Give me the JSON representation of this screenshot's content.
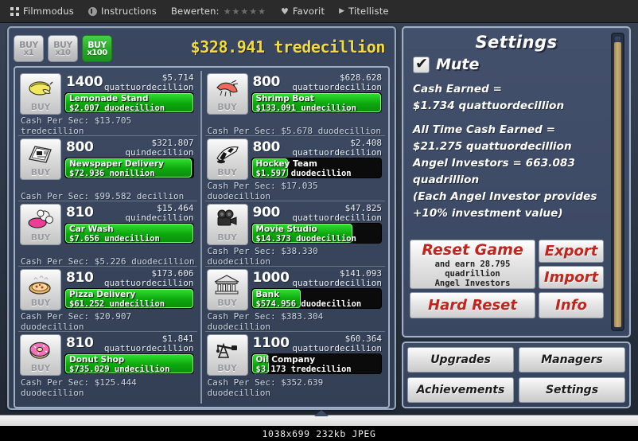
{
  "viewer": {
    "toolbar": [
      {
        "label": "Filmmodus",
        "icon": "grid-icon"
      },
      {
        "label": "Instructions",
        "icon": "info-circle-icon"
      },
      {
        "label": "Bewerten:",
        "icon": "none"
      },
      {
        "label": "Favorit",
        "icon": "heart-icon"
      },
      {
        "label": "Titelliste",
        "icon": "play-icon"
      }
    ],
    "stars": "★★★★★",
    "status": "1038x699  232kb  JPEG"
  },
  "game": {
    "buy_buttons": [
      {
        "line1": "BUY",
        "line2": "x1",
        "active": false
      },
      {
        "line1": "BUY",
        "line2": "x10",
        "active": false
      },
      {
        "line1": "BUY",
        "line2": "x100",
        "active": true
      }
    ],
    "cash": "$328.941 tredecillion",
    "buy_label": "BUY",
    "businesses_left": [
      {
        "name": "Lemonade Stand",
        "icon": "lemon-icon",
        "qty": "1400",
        "price_1": "$5.714",
        "price_2": "quattuordecillion",
        "revenue": "$2.007  duodecillion",
        "cps": "Cash Per Sec: $13.705 tredecillion",
        "progress": 100
      },
      {
        "name": "Newspaper Delivery",
        "icon": "newspaper-icon",
        "qty": "800",
        "price_1": "$321.807",
        "price_2": "quindecillion",
        "revenue": "$72.936  nonillion",
        "cps": "Cash Per Sec: $99.582 decillion",
        "progress": 99
      },
      {
        "name": "Car Wash",
        "icon": "car-wash-icon",
        "qty": "810",
        "price_1": "$15.464",
        "price_2": "quindecillion",
        "revenue": "$7.656  undecillion",
        "cps": "Cash Per Sec: $5.226 duodecillion",
        "progress": 100
      },
      {
        "name": "Pizza Delivery",
        "icon": "pizza-icon",
        "qty": "810",
        "price_1": "$173.606",
        "price_2": "quattuordecillion",
        "revenue": "$61.252  undecillion",
        "cps": "Cash Per Sec: $20.907 duodecillion",
        "progress": 100
      },
      {
        "name": "Donut Shop",
        "icon": "donut-icon",
        "qty": "810",
        "price_1": "$1.841",
        "price_2": "quattuordecillion",
        "revenue": "$735.029  undecillion",
        "cps": "Cash Per Sec: $125.444 duodecillion",
        "progress": 100
      }
    ],
    "businesses_right": [
      {
        "name": "Shrimp Boat",
        "icon": "shrimp-icon",
        "qty": "800",
        "price_1": "$628.628",
        "price_2": "quattuordecillion",
        "revenue": "$133.091 undecillion",
        "cps": "Cash Per Sec: $5.678 duodecillion",
        "progress": 100
      },
      {
        "name": "Hockey Team",
        "icon": "hockey-icon",
        "qty": "800",
        "price_1": "$2.408",
        "price_2": "quattuordecillion",
        "revenue": "$1.597  duodecillion",
        "cps": "Cash Per Sec: $17.035 duodecillion",
        "progress": 28
      },
      {
        "name": "Movie Studio",
        "icon": "movie-camera-icon",
        "qty": "900",
        "price_1": "$47.825",
        "price_2": "quattuordecillion",
        "revenue": "$14.373  duodecillion",
        "cps": "Cash Per Sec: $38.330 duodecillion",
        "progress": 78
      },
      {
        "name": "Bank",
        "icon": "bank-icon",
        "qty": "1000",
        "price_1": "$141.093",
        "price_2": "quattuordecillion",
        "revenue": "$574.956  duodecillion",
        "cps": "Cash Per Sec: $383.304 duodecillion",
        "progress": 38
      },
      {
        "name": "Oil Company",
        "icon": "oil-pump-icon",
        "qty": "1100",
        "price_1": "$60.364",
        "price_2": "quattuordecillion",
        "revenue": "$3.173  tredecillion",
        "cps": "Cash Per Sec: $352.639 duodecillion",
        "progress": 13
      }
    ]
  },
  "settings": {
    "title": "Settings",
    "mute_label": "Mute",
    "mute_checked": true,
    "stats": [
      "Cash Earned =",
      "$1.734 quattuordecillion",
      "All Time Cash Earned =",
      "$21.275 quattuordecillion",
      "Angel Investors = 663.083",
      "quadrillion",
      "(Each Angel Investor provides",
      "+10% investment value)"
    ],
    "reset_game_title": "Reset Game",
    "reset_game_sub_1": "and earn 28.795",
    "reset_game_sub_2": "quadrillion",
    "reset_game_sub_3": "Angel Investors",
    "hard_reset": "Hard Reset",
    "export": "Export",
    "import": "Import",
    "info": "Info"
  },
  "nav": {
    "upgrades": "Upgrades",
    "managers": "Managers",
    "achievements": "Achievements",
    "settings": "Settings"
  },
  "colors": {
    "cash_yellow": "#f2dc3c",
    "progress_green": "#0da80d",
    "active_buy_green": "#24a524",
    "reset_red": "#c2251d",
    "panel_blue": "#3a4760"
  }
}
